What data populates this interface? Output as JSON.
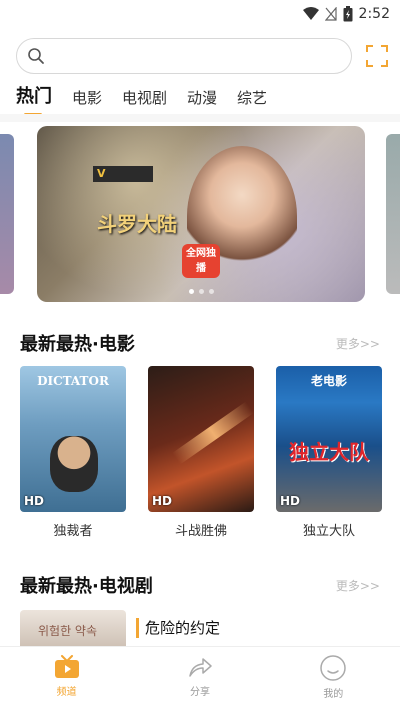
{
  "status_bar": {
    "time": "2:52"
  },
  "search": {
    "placeholder": ""
  },
  "tabs": [
    {
      "label": "热门",
      "active": true
    },
    {
      "label": "电影",
      "active": false
    },
    {
      "label": "电视剧",
      "active": false
    },
    {
      "label": "动漫",
      "active": false
    },
    {
      "label": "综艺",
      "active": false
    }
  ],
  "banner": {
    "logo_text": "V",
    "title": "斗罗大陆",
    "badge": "全网独播"
  },
  "movies_section": {
    "title": "最新最热·电影",
    "more": "更多>>",
    "items": [
      {
        "name": "独裁者",
        "poster_text": "DICTATOR",
        "hd": "HD"
      },
      {
        "name": "斗战胜佛",
        "poster_text": "",
        "hd": "HD"
      },
      {
        "name": "独立大队",
        "poster_text_top": "老电影",
        "poster_text_mid": "独立大队",
        "hd": "HD"
      }
    ]
  },
  "tv_section": {
    "title": "最新最热·电视剧",
    "more": "更多>>",
    "items": [
      {
        "name": "危险的约定",
        "thumb_text": "위험한 약속"
      }
    ]
  },
  "bottom_nav": [
    {
      "label": "频道",
      "icon": "tv-icon",
      "active": true
    },
    {
      "label": "分享",
      "icon": "share-icon",
      "active": false
    },
    {
      "label": "我的",
      "icon": "profile-icon",
      "active": false
    }
  ],
  "colors": {
    "accent": "#f3a633"
  }
}
